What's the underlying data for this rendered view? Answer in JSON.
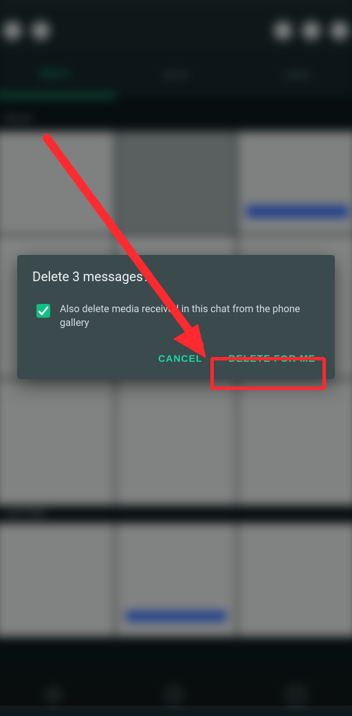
{
  "statusbar": {
    "left": "",
    "right": ""
  },
  "appbar": {
    "icon1": "back-icon",
    "icon2": "count-icon",
    "icon3": "star-icon",
    "icon4": "delete-icon",
    "icon5": "forward-icon"
  },
  "tabs": {
    "t1": "MEDIA",
    "t2": "DOCS",
    "t3": "LINKS"
  },
  "sections": {
    "s1": "Recent",
    "s2": "Last week"
  },
  "dialog": {
    "title": "Delete 3 messages?",
    "checkbox_label": "Also delete media received in this chat from the phone gallery",
    "checkbox_checked": true,
    "cancel_label": "CANCEL",
    "delete_label": "DELETE FOR ME"
  },
  "colors": {
    "accent": "#1ed9a0",
    "dialog_bg": "#3a4a4d",
    "annotation": "#ff2a2f"
  }
}
